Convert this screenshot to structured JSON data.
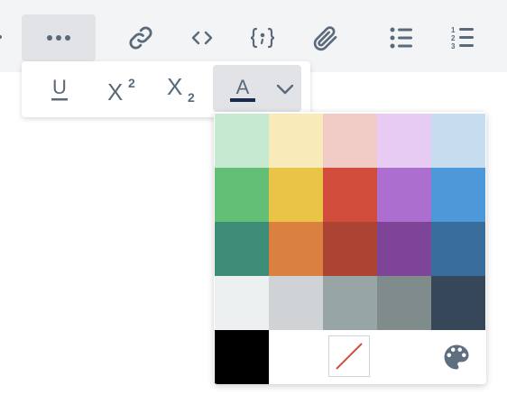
{
  "toolbar": {
    "items": [
      {
        "name": "more-button",
        "icon": "more-dots-icon"
      },
      {
        "name": "link-button",
        "icon": "link-icon"
      },
      {
        "name": "code-button",
        "icon": "code-icon"
      },
      {
        "name": "code-block-button",
        "icon": "code-block-icon"
      },
      {
        "name": "attachment-button",
        "icon": "paperclip-icon"
      },
      {
        "name": "bullet-list-button",
        "icon": "bullet-list-icon"
      },
      {
        "name": "numbered-list-button",
        "icon": "numbered-list-icon"
      }
    ],
    "numbered_list_glyphs": [
      "1",
      "2",
      "3"
    ]
  },
  "sub_toolbar": {
    "underline_glyph": "U",
    "superscript_glyph": "X",
    "superscript_mark": "2",
    "subscript_glyph": "X",
    "subscript_mark": "2",
    "text_color_glyph": "A",
    "current_text_color": "#172b4d"
  },
  "palette": {
    "colors": [
      [
        "#c6e9d1",
        "#f8ebb9",
        "#f0cbc5",
        "#e7cbf3",
        "#c6ddf0"
      ],
      [
        "#63bf75",
        "#eac446",
        "#d24c3b",
        "#ad6fcf",
        "#4d98d8"
      ],
      [
        "#3d8c77",
        "#db813f",
        "#ad4333",
        "#7d4498",
        "#396d9c"
      ],
      [
        "#ecf0f1",
        "#cfd3d6",
        "#98a5a6",
        "#7f8c8b",
        "#354759"
      ]
    ],
    "black": "#000000",
    "remove_color_icon": "no-color-icon",
    "custom_color_icon": "palette-icon",
    "remove_slash_color": "#d24c3b",
    "custom_icon_color": "#5f6f80"
  }
}
